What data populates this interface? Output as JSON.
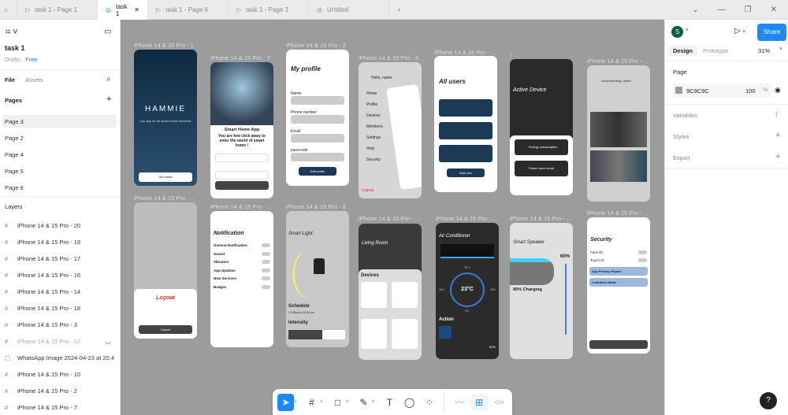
{
  "tabs": [
    {
      "label": "task 1 - Page 1"
    },
    {
      "label": "task 1"
    },
    {
      "label": "task 1 - Page 6"
    },
    {
      "label": "task 1 - Page 3"
    },
    {
      "label": "Untitled"
    }
  ],
  "file": {
    "name": "task 1",
    "location": "Drafts",
    "plan": "Free"
  },
  "panel_tabs": {
    "file": "File",
    "assets": "Assets"
  },
  "pages": {
    "title": "Pages",
    "items": [
      "Page 3",
      "Page 2",
      "Page 4",
      "Page 5",
      "Page 6"
    ]
  },
  "layers": {
    "title": "Layers",
    "items": [
      "iPhone 14 & 15 Pro - 20",
      "iPhone 14 & 15 Pro - 19",
      "iPhone 14 & 15 Pro - 17",
      "iPhone 14 & 15 Pro - 16",
      "iPhone 14 & 15 Pro - 14",
      "iPhone 14 & 15 Pro - 18",
      "iPhone 14 & 15 Pro - 3",
      "iPhone 14 & 15 Pro - 12",
      "WhatsApp Image 2024-04-23 at 20.4",
      "iPhone 14 & 15 Pro - 10",
      "iPhone 14 & 15 Pro - 2",
      "iPhone 14 & 15 Pro - 7"
    ]
  },
  "right": {
    "avatar": "S",
    "share": "Share",
    "design": "Design",
    "prototype": "Prototype",
    "zoom": "31%",
    "page_title": "Page",
    "page_color": "9C9C9C",
    "page_opacity": "100",
    "pct": "%",
    "variables": "Variables",
    "styles": "Styles",
    "export": "Export",
    "help": "?"
  },
  "colors": {
    "accent": "#1e88f5",
    "canvas": "#9c9c9c",
    "navy": "#1c3a56"
  },
  "frames": {
    "f1": {
      "label": "iPhone 14 & 15 Pro - 1",
      "logo": "HAMMIE",
      "tagline": "one app for all smart home elements",
      "cta": "Get smart"
    },
    "f7": {
      "label": "iPhone 14 & 15 Pro - 7",
      "title": "Smart Home App",
      "subtitle": "You are few click away to enter the world of smart home !"
    },
    "f2": {
      "label": "iPhone 14 & 15 Pro - 2",
      "title": "My profile",
      "name": "Name",
      "phone": "Phone number",
      "email": "Email",
      "passcode": "passcode",
      "edit": "Edit profile"
    },
    "f3": {
      "label": "iPhone 14 & 15 Pro - 3",
      "hello": "Hello, name",
      "menu": [
        "Home",
        "Profile",
        "Devices",
        "Members",
        "Settings",
        "Help",
        "Security"
      ],
      "logout": "Logout"
    },
    "users": {
      "label": "iPhone 14 & 15 Pro - ...",
      "title": "All users",
      "add": "Add user"
    },
    "active": {
      "label": "|",
      "title": "Active Device",
      "energy": "Energy consumption",
      "power": "Power save mode"
    },
    "home": {
      "label": "iPhone 14 & 15 Pro - ...",
      "greeting": "Good morning, name"
    },
    "logoutf": {
      "label": "iPhone 14 & 15 Pro - ...",
      "title": "Logout",
      "cancel": "Cancel"
    },
    "notif": {
      "label": "iPhone 14 & 15 Pro - ...",
      "title": "Notification",
      "items": [
        "General Notification",
        "Sound",
        "Vibration",
        "App Updates",
        "New Services",
        "Badges"
      ]
    },
    "light": {
      "label": "iPhone 14 & 15 Pro - 8",
      "title": "Smart Light",
      "schedule": "Schedule",
      "time": "12:00pm  to  10:00 pm",
      "intensity": "Intensity"
    },
    "living": {
      "label": "iPhone 14 & 15 Pro - ...",
      "title": "Living Room",
      "devices": "Devices"
    },
    "ac": {
      "label": "iPhone 14 & 15 Pro - ...",
      "title": "Air Conditioner",
      "temp": "23°C",
      "top": "20°c",
      "left": "16°c",
      "right": "30°c",
      "bottom": "8°c",
      "action": "Action",
      "fan": "50%"
    },
    "speaker": {
      "label": "iPhone 14 & 15 Pro - ...",
      "title": "Smart Speaker",
      "volume": "60%",
      "charging": "89% Charging"
    },
    "security": {
      "label": "iPhone 14 & 15 Pro - ...",
      "title": "Security",
      "face": "Face ID",
      "touch": "Touch ID",
      "privacy": "App Privacy Report",
      "lockdown": "Lockdown Mode"
    }
  }
}
